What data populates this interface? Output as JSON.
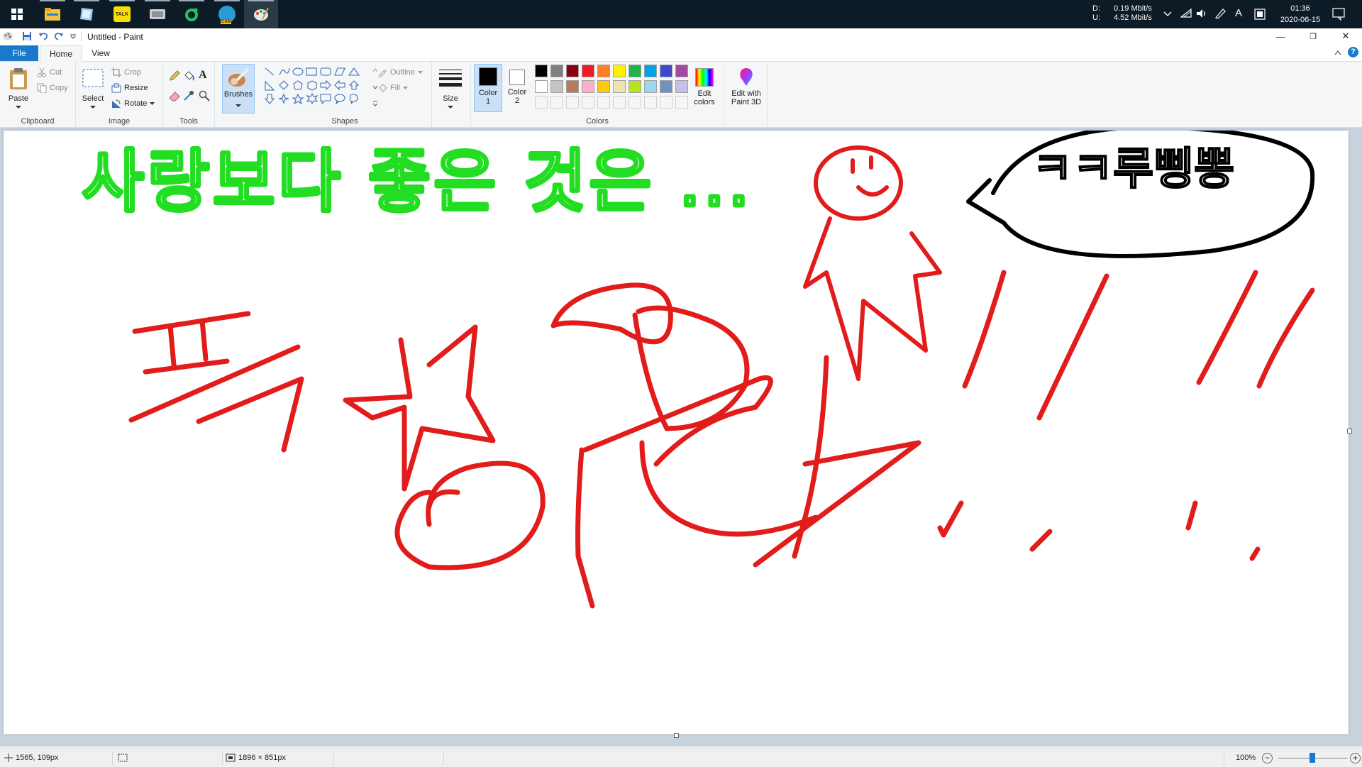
{
  "taskbar": {
    "apps": [
      {
        "name": "file-explorer"
      },
      {
        "name": "notes-app"
      },
      {
        "name": "kakaotalk",
        "badge": "TALK"
      },
      {
        "name": "device-app"
      },
      {
        "name": "green-ring-app"
      },
      {
        "name": "edge-canary",
        "badge": "CAN"
      },
      {
        "name": "paint"
      }
    ],
    "network": {
      "down_label": "D:",
      "up_label": "U:",
      "down_rate": "0.19 Mbit/s",
      "up_rate": "4.52 Mbit/s"
    },
    "ime": "A",
    "clock": {
      "time": "01:36",
      "date": "2020-06-15"
    }
  },
  "window": {
    "title": "Untitled - Paint",
    "controls": {
      "minimize": "—",
      "restore": "❐",
      "close": "✕"
    }
  },
  "tabs": {
    "file": "File",
    "home": "Home",
    "view": "View"
  },
  "ribbon": {
    "clipboard": {
      "paste": "Paste",
      "cut": "Cut",
      "copy": "Copy",
      "group": "Clipboard"
    },
    "image": {
      "select": "Select",
      "crop": "Crop",
      "resize": "Resize",
      "rotate": "Rotate",
      "group": "Image"
    },
    "tools": {
      "group": "Tools",
      "text_tool": "A"
    },
    "brushes": {
      "label": "Brushes"
    },
    "shapes": {
      "outline": "Outline",
      "fill": "Fill",
      "group": "Shapes"
    },
    "size": {
      "label": "Size"
    },
    "colors": {
      "color1": "Color 1",
      "color1_line2": "1",
      "color1_line1": "Color",
      "color2_line1": "Color",
      "color2_line2": "2",
      "edit_line1": "Edit",
      "edit_line2": "colors",
      "paint3d_line1": "Edit with",
      "paint3d_line2": "Paint 3D",
      "group": "Colors",
      "color1_value": "#000000",
      "color2_value": "#ffffff",
      "palette_row1": [
        "#000000",
        "#7f7f7f",
        "#880015",
        "#ed1c24",
        "#ff7f27",
        "#fff200",
        "#22b14c",
        "#00a2e8",
        "#3f48cc",
        "#a349a4"
      ],
      "palette_row2": [
        "#ffffff",
        "#c3c3c3",
        "#b97a57",
        "#ffaec9",
        "#ffc90e",
        "#efe4b0",
        "#b5e61d",
        "#99d9ea",
        "#7092be",
        "#c8bfe7"
      ]
    }
  },
  "drawing": {
    "green_text": "사랑보다 좋은 것은 ...",
    "speech_text": "ㅋㅋ루삥뽕",
    "colors": {
      "green": "#22dd22",
      "red": "#e21b1b",
      "black": "#000000"
    }
  },
  "status": {
    "cursor_pos": "1565, 109px",
    "canvas_size": "1896 × 851px",
    "zoom": "100%"
  }
}
